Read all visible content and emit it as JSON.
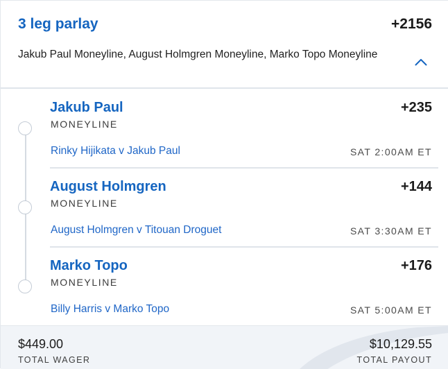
{
  "header": {
    "title": "3 leg parlay",
    "odds": "+2156",
    "description": "Jakub Paul Moneyline, August Holmgren Moneyline, Marko Topo Moneyline",
    "collapse_icon": "chevron-up-icon"
  },
  "legs": [
    {
      "selection": "Jakub Paul",
      "odds": "+235",
      "market": "MONEYLINE",
      "event": "Rinky Hijikata v Jakub Paul",
      "time": "SAT 2:00AM ET"
    },
    {
      "selection": "August Holmgren",
      "odds": "+144",
      "market": "MONEYLINE",
      "event": "August Holmgren v Titouan Droguet",
      "time": "SAT 3:30AM ET"
    },
    {
      "selection": "Marko Topo",
      "odds": "+176",
      "market": "MONEYLINE",
      "event": "Billy Harris v Marko Topo",
      "time": "SAT 5:00AM ET"
    }
  ],
  "footer": {
    "wager_amount": "$449.00",
    "wager_label": "TOTAL WAGER",
    "payout_amount": "$10,129.55",
    "payout_label": "TOTAL PAYOUT"
  },
  "colors": {
    "accent": "#1565c0",
    "link": "#1f66c7",
    "footer_bg": "#f1f4f8",
    "divider": "#dfe4ea"
  }
}
